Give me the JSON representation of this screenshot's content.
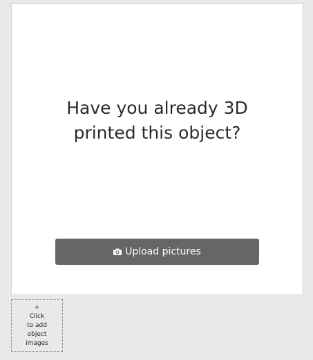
{
  "prompt": {
    "question_line1": "Have you already 3D",
    "question_line2": "printed this object?"
  },
  "upload": {
    "label": "Upload pictures",
    "icon": "camera-icon"
  },
  "add_images": {
    "plus": "+",
    "line1": "Click",
    "line2": "to add",
    "line3": "object",
    "line4": "images"
  },
  "colors": {
    "page_bg": "#e9e9e9",
    "panel_bg": "#ffffff",
    "button_bg": "#666666",
    "text": "#2b2b2b"
  }
}
